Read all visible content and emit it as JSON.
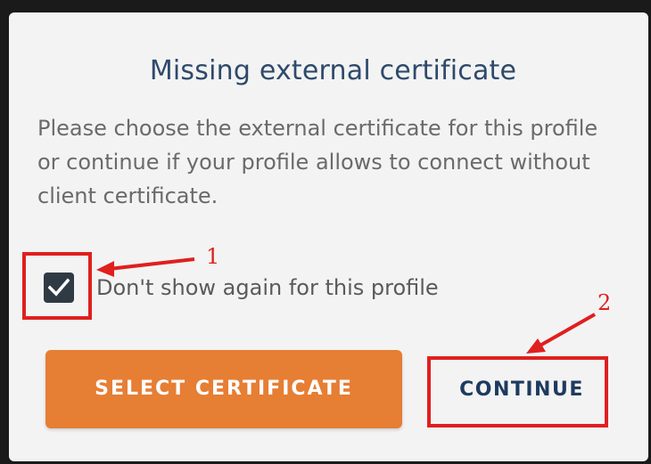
{
  "dialog": {
    "title": "Missing external certificate",
    "description": "Please choose the external certificate for this profile or continue if your profile allows to connect without client certificate.",
    "checkbox": {
      "label": "Don't show again for this profile",
      "checked": true
    },
    "buttons": {
      "select_certificate": "SELECT CERTIFICATE",
      "continue": "CONTINUE"
    }
  },
  "annotations": {
    "step1": "1",
    "step2": "2"
  },
  "colors": {
    "accent": "#e67e34",
    "title": "#2e4a6b",
    "annotation": "#e01f1f",
    "checkbox": "#2f3a45"
  }
}
